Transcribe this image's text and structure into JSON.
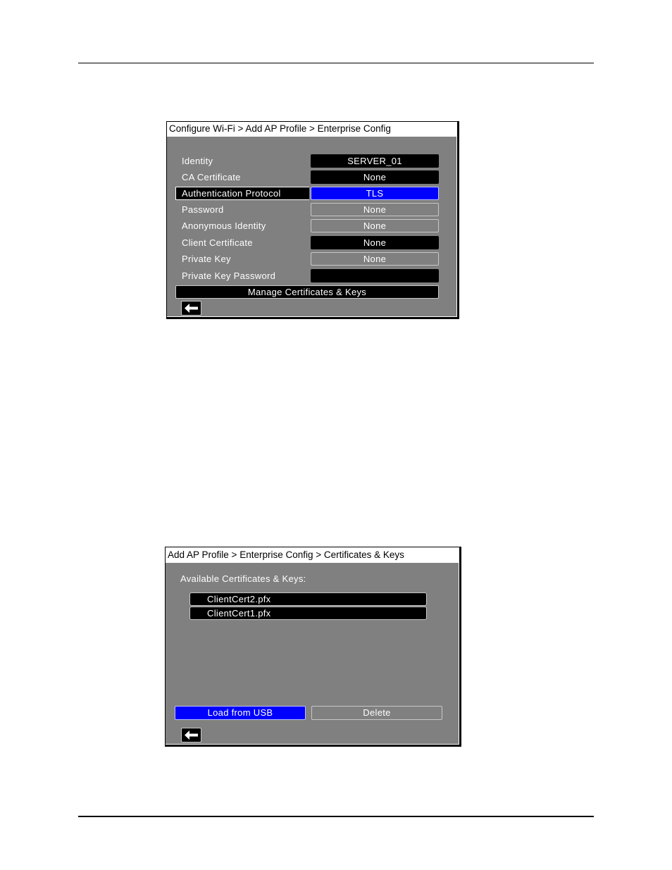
{
  "screen1": {
    "breadcrumb": "Configure Wi-Fi > Add AP Profile > Enterprise Config",
    "fields": [
      {
        "label": "Identity",
        "value": "SERVER_01",
        "style": "black",
        "selected": false
      },
      {
        "label": "CA Certificate",
        "value": "None",
        "style": "black",
        "selected": false
      },
      {
        "label": "Authentication Protocol",
        "value": "TLS",
        "style": "blue",
        "selected": true
      },
      {
        "label": "Password",
        "value": "None",
        "style": "outline",
        "selected": false
      },
      {
        "label": "Anonymous Identity",
        "value": "None",
        "style": "outline",
        "selected": false
      },
      {
        "label": "Client Certificate",
        "value": "None",
        "style": "black",
        "selected": false
      },
      {
        "label": "Private Key",
        "value": "None",
        "style": "outline",
        "selected": false
      },
      {
        "label": "Private Key Password",
        "value": "",
        "style": "black",
        "selected": false
      }
    ],
    "manage_button": "Manage Certificates & Keys",
    "back_icon": "arrow-left-icon"
  },
  "screen2": {
    "breadcrumb": "Add AP Profile > Enterprise Config > Certificates & Keys",
    "list_label": "Available Certificates & Keys:",
    "items": [
      "ClientCert2.pfx",
      "ClientCert1.pfx"
    ],
    "load_button": "Load from USB",
    "delete_button": "Delete",
    "back_icon": "arrow-left-icon"
  },
  "colors": {
    "screen_bg": "#808080",
    "selected_blue": "#0000ff",
    "field_black": "#000000",
    "title_bg": "#ffffff"
  }
}
